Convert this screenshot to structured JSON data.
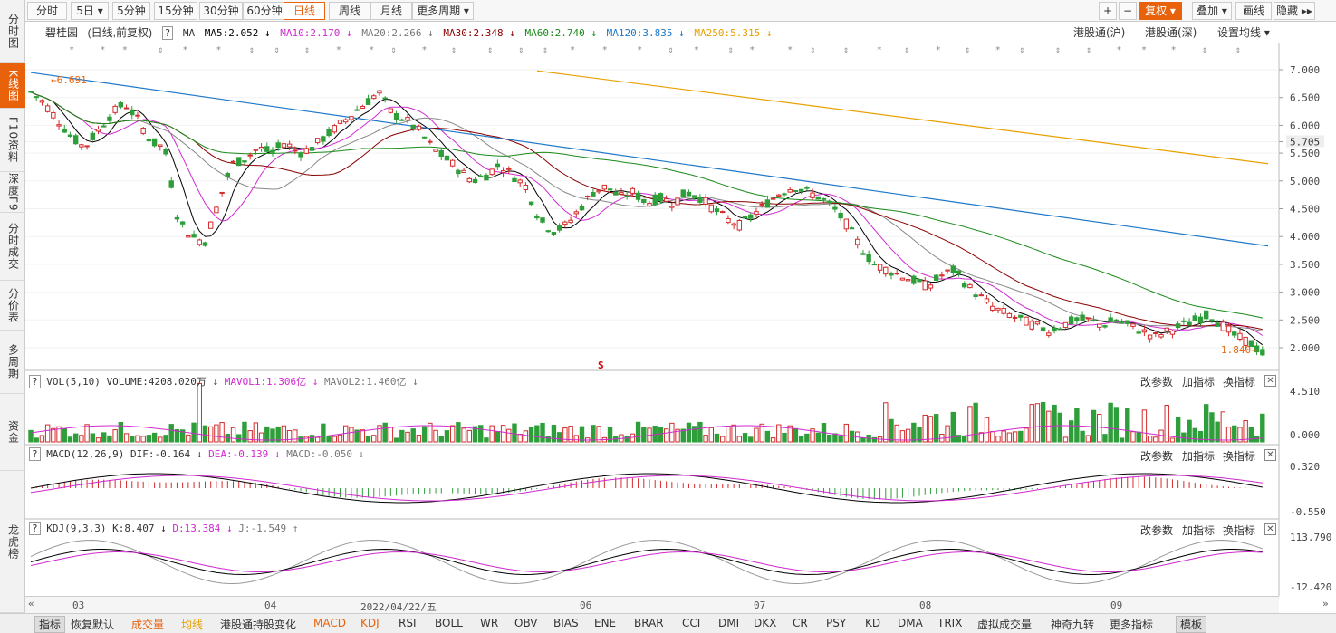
{
  "left_tabs": [
    "分时图",
    "K线图",
    "F10资料",
    "深度F9",
    "分时成交",
    "分价表",
    "多周期",
    "资金",
    "龙虎榜"
  ],
  "period_buttons": [
    "分时",
    "5日 ▾",
    "5分钟",
    "15分钟",
    "30分钟",
    "60分钟",
    "日线",
    "周线",
    "月线",
    "更多周期 ▾"
  ],
  "right_buttons": [
    "+",
    "−",
    "复权 ▾",
    "叠加 ▾",
    "画线",
    "隐藏 ▸▸"
  ],
  "stock": {
    "name": "碧桂园",
    "mode": "(日线,前复权)",
    "help": "?"
  },
  "ma": {
    "label": "MA",
    "ma5": "MA5:2.052 ↓",
    "ma10": "MA10:2.170 ↓",
    "ma20": "MA20:2.266 ↓",
    "ma30": "MA30:2.348 ↓",
    "ma60": "MA60:2.740 ↓",
    "ma120": "MA120:3.835 ↓",
    "ma250": "MA250:5.315 ↓"
  },
  "top_right": {
    "hk_sh": "港股通(沪)",
    "hk_sz": "港股通(深)",
    "settings": "设置均线 ▾"
  },
  "price_axis": [
    "7.000",
    "6.500",
    "6.000",
    "5.705",
    "5.500",
    "5.000",
    "4.500",
    "4.000",
    "3.500",
    "3.000",
    "2.500",
    "2.000"
  ],
  "high_label": "6.691",
  "low_label": "1.840",
  "s_marker": "S",
  "vol": {
    "title": "VOL(5,10)",
    "volume": "VOLUME:4208.020万 ↓",
    "mavol1": "MAVOL1:1.306亿 ↓",
    "mavol2": "MAVOL2:1.460亿 ↓",
    "axis_top": "4.510",
    "axis_bottom": "0.000"
  },
  "macd": {
    "title": "MACD(12,26,9)",
    "dif": "DIF:-0.164 ↓",
    "dea": "DEA:-0.139 ↓",
    "macd": "MACD:-0.050 ↓",
    "axis_top": "0.320",
    "axis_bottom": "-0.550"
  },
  "kdj": {
    "title": "KDJ(9,3,3)",
    "k": "K:8.407 ↓",
    "d": "D:13.384 ↓",
    "j": "J:-1.549 ↑",
    "axis_top": "113.790",
    "axis_bottom": "-12.420"
  },
  "panel_buttons": {
    "change": "改参数",
    "add": "加指标",
    "swap": "换指标",
    "close": "✕"
  },
  "x_axis": [
    "03",
    "04",
    "2022/04/22/五",
    "06",
    "07",
    "08",
    "09"
  ],
  "bottom_tabs": [
    "指标",
    "恢复默认",
    "成交量",
    "均线",
    "港股通持股变化",
    "MACD",
    "KDJ",
    "RSI",
    "BOLL",
    "WR",
    "OBV",
    "BIAS",
    "ENE",
    "BRAR",
    "CCI",
    "DMI",
    "DKX",
    "CR",
    "PSY",
    "KD",
    "DMA",
    "TRIX",
    "虚拟成交量",
    "神奇九转",
    "更多指标",
    "模板"
  ],
  "colors": {
    "up": "#d42c2c",
    "down": "#2e9e3a",
    "ma5": "#000000",
    "ma10": "#d02ad0",
    "ma20": "#888888",
    "ma30": "#8b0000",
    "ma60": "#1a8a1a",
    "ma120": "#1e78c8",
    "ma250": "#e8a000",
    "accent": "#e8620c"
  }
}
